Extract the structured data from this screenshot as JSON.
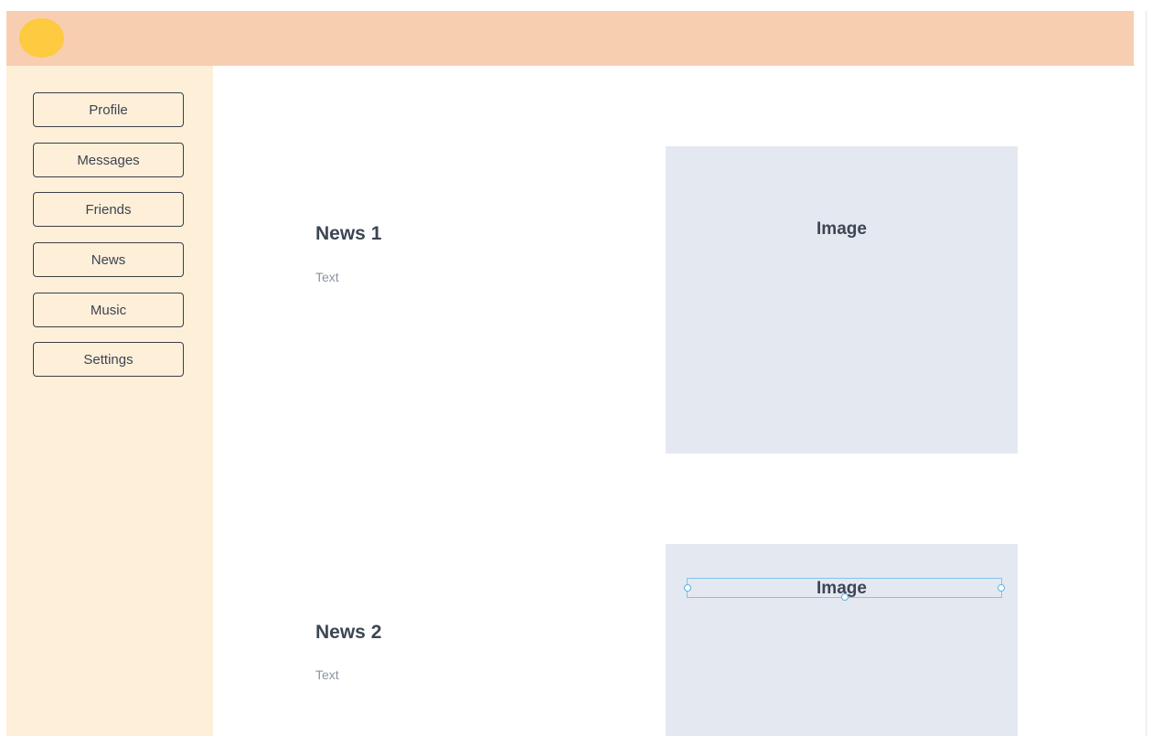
{
  "header": {
    "avatar_icon": "user-avatar-circle",
    "colors": {
      "header_bg": "#f8ceb0",
      "avatar": "#fdca40",
      "sidebar_bg": "#feefd9",
      "image_bg": "#e4e8f1",
      "selection": "#7ec5ea"
    }
  },
  "sidebar": {
    "items": [
      {
        "label": "Profile"
      },
      {
        "label": "Messages"
      },
      {
        "label": "Friends"
      },
      {
        "label": "News"
      },
      {
        "label": "Music"
      },
      {
        "label": "Settings"
      }
    ]
  },
  "feed": {
    "posts": [
      {
        "title": "News 1",
        "text": "Text",
        "image_label": "Image"
      },
      {
        "title": "News 2",
        "text": "Text",
        "image_label": "Image"
      }
    ]
  }
}
